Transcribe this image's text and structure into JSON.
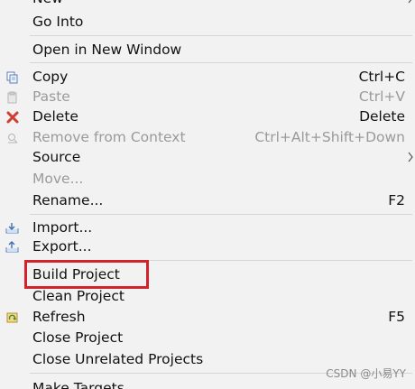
{
  "menu": {
    "items": [
      {
        "label": "New"
      },
      {
        "label": "Go Into"
      },
      {
        "label": "Open in New Window"
      },
      {
        "label": "Copy",
        "shortcut": "Ctrl+C",
        "icon": "copy-icon"
      },
      {
        "label": "Paste",
        "shortcut": "Ctrl+V",
        "icon": "paste-icon",
        "disabled": true
      },
      {
        "label": "Delete",
        "shortcut": "Delete",
        "icon": "delete-icon"
      },
      {
        "label": "Remove from Context",
        "shortcut": "Ctrl+Alt+Shift+Down",
        "icon": "remove-from-context-icon",
        "disabled": true
      },
      {
        "label": "Source"
      },
      {
        "label": "Move...",
        "disabled": true
      },
      {
        "label": "Rename...",
        "shortcut": "F2"
      },
      {
        "label": "Import...",
        "icon": "import-icon"
      },
      {
        "label": "Export...",
        "icon": "export-icon"
      },
      {
        "label": "Build Project",
        "highlighted": true
      },
      {
        "label": "Clean Project"
      },
      {
        "label": "Refresh",
        "shortcut": "F5",
        "icon": "refresh-icon"
      },
      {
        "label": "Close Project"
      },
      {
        "label": "Close Unrelated Projects"
      },
      {
        "label": "Make Targets"
      }
    ]
  },
  "colors": {
    "menu_background": "#f2f2f2",
    "highlight_border": "#d2232a",
    "disabled_text": "#9a9a9a"
  },
  "watermark": "CSDN @小易YY"
}
